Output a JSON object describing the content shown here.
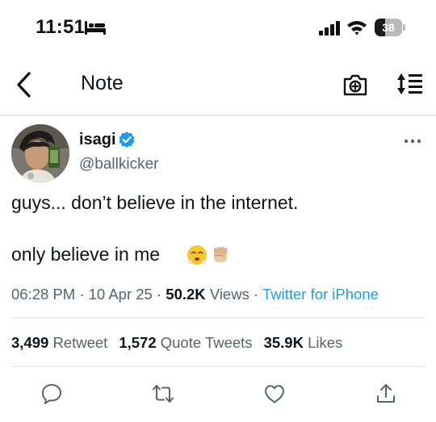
{
  "status_bar": {
    "time": "11:51",
    "battery_level": "38",
    "battery_fraction": 0.38
  },
  "nav": {
    "title": "Note",
    "icons": [
      "back-icon",
      "camera-icon",
      "sort-icon"
    ]
  },
  "tweet": {
    "display_name": "isagi",
    "handle": "@ballkicker",
    "verified": true,
    "text_line_1": "guys... don’t believe in the internet.",
    "text_line_2": "only believe in me",
    "emojis": [
      "face-with-steam-emoji",
      "raised-fist-emoji"
    ],
    "time": "06:28 PM",
    "date": "10 Apr 25",
    "views_count": "50.2K",
    "views_label": "Views",
    "source": "Twitter for iPhone"
  },
  "stats": {
    "retweets_count": "3,499",
    "retweets_label": "Retweet",
    "quotes_count": "1,572",
    "quotes_label": "Quote Tweets",
    "likes_count": "35.9K",
    "likes_label": "Likes"
  },
  "actions": [
    "reply-icon",
    "retweet-icon",
    "like-icon",
    "share-icon"
  ],
  "colors": {
    "accent": "#1d9bf0",
    "text_primary": "#0f1419",
    "text_secondary": "#536471",
    "divider": "#e1e4e6"
  }
}
